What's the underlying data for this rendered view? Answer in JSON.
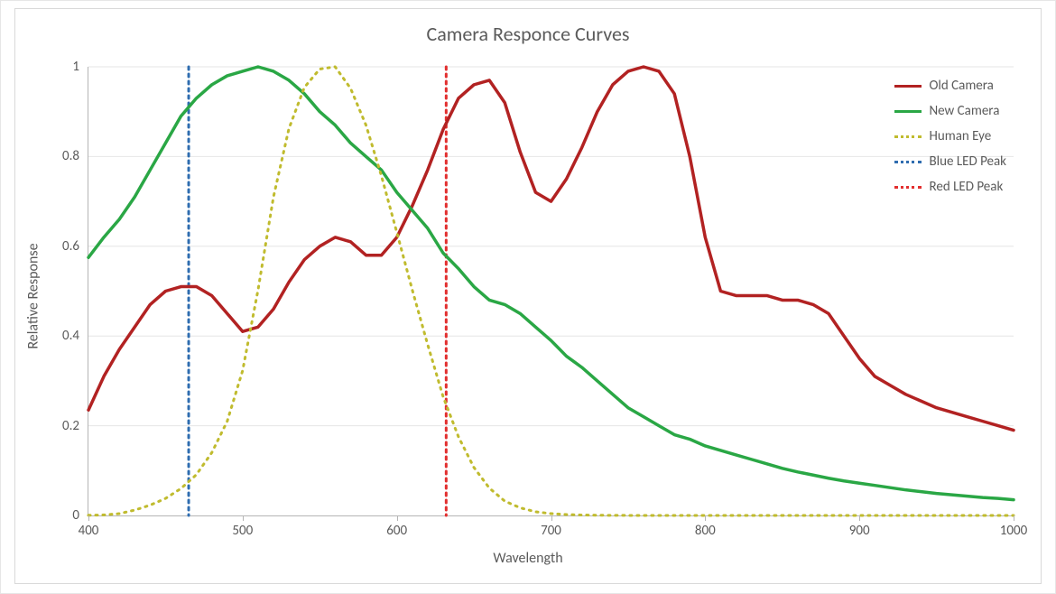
{
  "chart_data": {
    "type": "line",
    "title": "Camera Responce Curves",
    "xlabel": "Wavelength",
    "ylabel": "Relative Response",
    "xlim": [
      400,
      1000
    ],
    "ylim": [
      0,
      1
    ],
    "xticks": [
      400,
      500,
      600,
      700,
      800,
      900,
      1000
    ],
    "yticks": [
      0,
      0.2,
      0.4,
      0.6,
      0.8,
      1
    ],
    "grid": {
      "horizontal": true,
      "vertical": false
    },
    "legend_position": "top-right-inside",
    "vlines": [
      {
        "name": "Blue LED Peak",
        "x": 465,
        "color": "#2f6db0",
        "style": "dotted"
      },
      {
        "name": "Red LED Peak",
        "x": 632,
        "color": "#e22f2f",
        "style": "dotted"
      }
    ],
    "series": [
      {
        "name": "Old Camera",
        "color": "#B22222",
        "style": "solid",
        "width": 3.5,
        "x": [
          400,
          410,
          420,
          430,
          440,
          450,
          460,
          470,
          480,
          490,
          500,
          510,
          520,
          530,
          540,
          550,
          560,
          570,
          580,
          590,
          600,
          610,
          620,
          630,
          640,
          650,
          660,
          670,
          680,
          690,
          700,
          710,
          720,
          730,
          740,
          750,
          760,
          770,
          780,
          790,
          800,
          810,
          820,
          830,
          840,
          850,
          860,
          870,
          880,
          890,
          900,
          910,
          920,
          930,
          940,
          950,
          960,
          970,
          980,
          990,
          1000
        ],
        "y": [
          0.235,
          0.31,
          0.37,
          0.42,
          0.47,
          0.5,
          0.51,
          0.51,
          0.49,
          0.45,
          0.41,
          0.42,
          0.46,
          0.52,
          0.57,
          0.6,
          0.62,
          0.61,
          0.58,
          0.58,
          0.62,
          0.69,
          0.77,
          0.86,
          0.93,
          0.96,
          0.97,
          0.92,
          0.81,
          0.72,
          0.7,
          0.75,
          0.82,
          0.9,
          0.96,
          0.99,
          1.0,
          0.99,
          0.94,
          0.8,
          0.62,
          0.5,
          0.49,
          0.49,
          0.49,
          0.48,
          0.48,
          0.47,
          0.45,
          0.4,
          0.35,
          0.31,
          0.29,
          0.27,
          0.255,
          0.24,
          0.23,
          0.22,
          0.21,
          0.2,
          0.19
        ]
      },
      {
        "name": "New Camera",
        "color": "#2aa745",
        "style": "solid",
        "width": 3.5,
        "x": [
          400,
          410,
          420,
          430,
          440,
          450,
          460,
          470,
          480,
          490,
          500,
          510,
          520,
          530,
          540,
          550,
          560,
          570,
          580,
          590,
          600,
          610,
          620,
          630,
          640,
          650,
          660,
          670,
          680,
          690,
          700,
          710,
          720,
          730,
          740,
          750,
          760,
          770,
          780,
          790,
          800,
          810,
          820,
          830,
          840,
          850,
          860,
          870,
          880,
          890,
          900,
          910,
          920,
          930,
          940,
          950,
          960,
          970,
          980,
          990,
          1000
        ],
        "y": [
          0.575,
          0.62,
          0.66,
          0.71,
          0.77,
          0.83,
          0.89,
          0.93,
          0.96,
          0.98,
          0.99,
          1.0,
          0.99,
          0.97,
          0.94,
          0.9,
          0.87,
          0.83,
          0.8,
          0.77,
          0.72,
          0.68,
          0.64,
          0.585,
          0.55,
          0.51,
          0.48,
          0.47,
          0.45,
          0.42,
          0.39,
          0.355,
          0.33,
          0.3,
          0.27,
          0.24,
          0.22,
          0.2,
          0.18,
          0.17,
          0.155,
          0.145,
          0.135,
          0.125,
          0.115,
          0.105,
          0.097,
          0.09,
          0.083,
          0.077,
          0.072,
          0.067,
          0.062,
          0.057,
          0.053,
          0.049,
          0.046,
          0.043,
          0.04,
          0.038,
          0.035
        ]
      },
      {
        "name": "Human Eye",
        "color": "#c0bb2e",
        "style": "dotted",
        "width": 3,
        "x": [
          400,
          410,
          420,
          430,
          440,
          450,
          460,
          470,
          480,
          490,
          500,
          510,
          520,
          530,
          540,
          550,
          560,
          570,
          580,
          590,
          600,
          610,
          620,
          630,
          640,
          650,
          660,
          670,
          680,
          690,
          700,
          710,
          720,
          730,
          740,
          750,
          760,
          770,
          780,
          790,
          800,
          810,
          820,
          830,
          840,
          850,
          860,
          870,
          880,
          890,
          900,
          910,
          920,
          930,
          940,
          950,
          960,
          970,
          980,
          990,
          1000
        ],
        "y": [
          0.0004,
          0.0012,
          0.004,
          0.012,
          0.023,
          0.038,
          0.06,
          0.091,
          0.14,
          0.21,
          0.323,
          0.503,
          0.71,
          0.862,
          0.954,
          0.995,
          1.0,
          0.952,
          0.87,
          0.757,
          0.631,
          0.503,
          0.381,
          0.265,
          0.175,
          0.107,
          0.061,
          0.032,
          0.017,
          0.0082,
          0.0041,
          0.0021,
          0.00105,
          0.00052,
          0.000249,
          0.00012,
          6e-05,
          3e-05,
          1.5e-05,
          0,
          0,
          0,
          0,
          0,
          0,
          0,
          0,
          0,
          0,
          0,
          0,
          0,
          0,
          0,
          0,
          0,
          0,
          0,
          0,
          0,
          0
        ]
      }
    ],
    "legend": [
      {
        "label": "Old Camera",
        "color": "#B22222",
        "style": "solid"
      },
      {
        "label": "New Camera",
        "color": "#2aa745",
        "style": "solid"
      },
      {
        "label": "Human Eye",
        "color": "#c0bb2e",
        "style": "dotted"
      },
      {
        "label": "Blue LED Peak",
        "color": "#2f6db0",
        "style": "dotted"
      },
      {
        "label": "Red LED Peak",
        "color": "#e22f2f",
        "style": "dotted"
      }
    ]
  }
}
